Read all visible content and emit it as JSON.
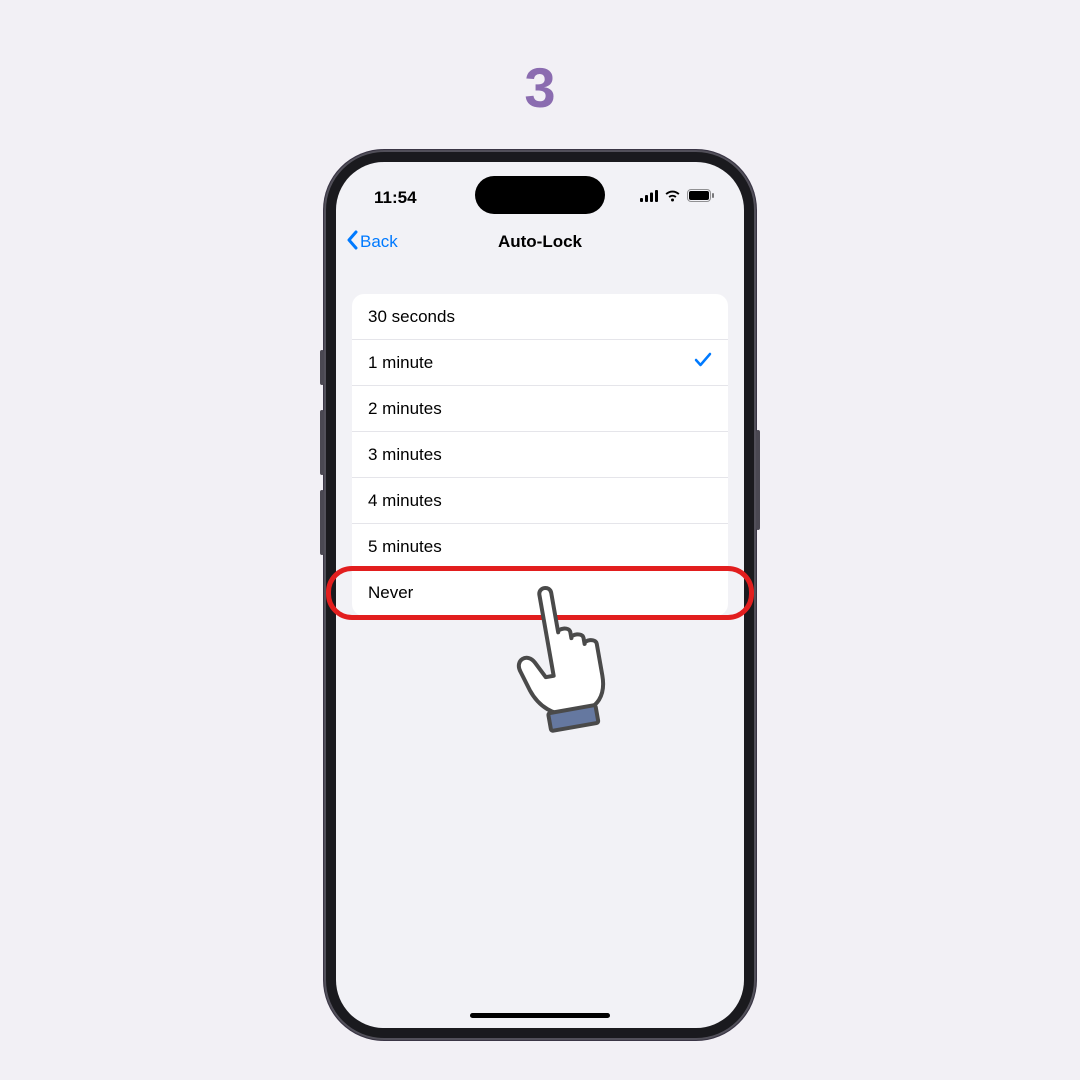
{
  "step_number": "3",
  "status": {
    "time": "11:54"
  },
  "nav": {
    "back_label": "Back",
    "title": "Auto-Lock"
  },
  "options": [
    {
      "label": "30 seconds",
      "selected": false,
      "highlighted": false
    },
    {
      "label": "1 minute",
      "selected": true,
      "highlighted": false
    },
    {
      "label": "2 minutes",
      "selected": false,
      "highlighted": false
    },
    {
      "label": "3 minutes",
      "selected": false,
      "highlighted": false
    },
    {
      "label": "4 minutes",
      "selected": false,
      "highlighted": false
    },
    {
      "label": "5 minutes",
      "selected": false,
      "highlighted": false
    },
    {
      "label": "Never",
      "selected": false,
      "highlighted": true
    }
  ],
  "colors": {
    "accent": "#007aff",
    "highlight": "#e21e1e",
    "step": "#8b6cb0"
  }
}
